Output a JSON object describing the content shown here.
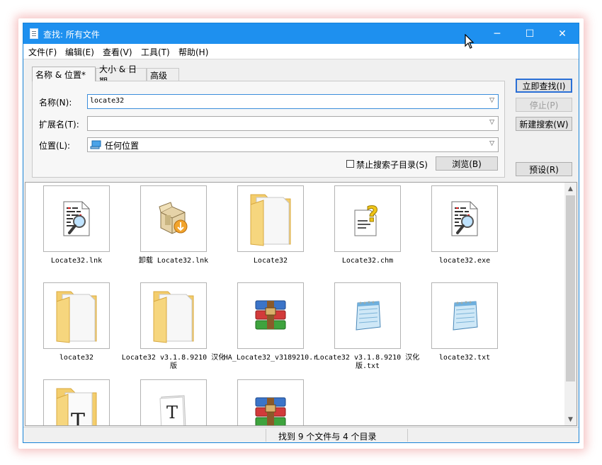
{
  "window": {
    "title": "查找: 所有文件"
  },
  "title_buttons": {
    "minimize": "─",
    "maximize": "☐",
    "close": "✕"
  },
  "menu": {
    "items": [
      "文件(F)",
      "编辑(E)",
      "查看(V)",
      "工具(T)",
      "帮助(H)"
    ]
  },
  "tabs": [
    "名称 & 位置*",
    "大小 & 日期",
    "高级"
  ],
  "form": {
    "name_label": "名称(N):",
    "name_value": "locate32",
    "ext_label": "扩展名(T):",
    "ext_value": "",
    "location_label": "位置(L):",
    "location_value": "任何位置",
    "no_subdir_label": "禁止搜索子目录(S)",
    "browse_label": "浏览(B)"
  },
  "buttons": {
    "find_now": "立即查找(I)",
    "stop": "停止(P)",
    "new_search": "新建搜索(W)",
    "preset": "预设(R)"
  },
  "results": [
    {
      "label": "Locate32.lnk",
      "icon": "magnifier-document-icon"
    },
    {
      "label": "卸载 Locate32.lnk",
      "icon": "uninstall-box-icon"
    },
    {
      "label": "Locate32",
      "icon": "folder-icon"
    },
    {
      "label": "Locate32.chm",
      "icon": "help-document-icon"
    },
    {
      "label": "locate32.exe",
      "icon": "magnifier-document-icon"
    },
    {
      "label": "locate32",
      "icon": "folder-icon"
    },
    {
      "label": "Locate32 v3.1.8.9210 汉化版",
      "icon": "folder-icon"
    },
    {
      "label": "HA_Locate32_v3189210.r",
      "icon": "winrar-archive-icon"
    },
    {
      "label": "Locate32 v3.1.8.9210 汉化版.txt",
      "icon": "notepad-icon"
    },
    {
      "label": "locate32.txt",
      "icon": "notepad-icon"
    },
    {
      "label": "",
      "icon": "font-folder-icon"
    },
    {
      "label": "",
      "icon": "font-file-icon"
    },
    {
      "label": "",
      "icon": "winrar-archive-icon"
    }
  ],
  "status": {
    "text": "找到 9 个文件与 4 个目录"
  }
}
